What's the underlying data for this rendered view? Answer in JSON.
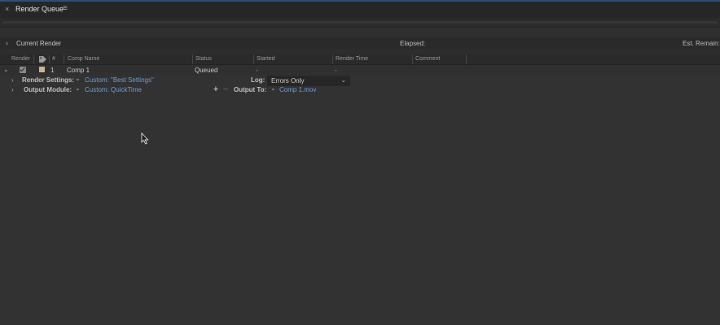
{
  "panel": {
    "title": "Render Queue",
    "close_icon": "×",
    "menu_icon": "≡"
  },
  "current_render": {
    "label": "Current Render",
    "elapsed_label": "Elapsed:",
    "remain_label": "Est. Remain:"
  },
  "columns": {
    "render": "Render",
    "number": "#",
    "comp_name": "Comp Name",
    "status": "Status",
    "started": "Started",
    "render_time": "Render Time",
    "comment": "Comment"
  },
  "queue_item": {
    "checked": true,
    "label_color": "#cbb48f",
    "number": "1",
    "comp_name": "Comp 1",
    "status": "Queued",
    "started": "-",
    "render_time": "-",
    "render_settings_label": "Render Settings:",
    "render_settings_value": "Custom: \"Best Settings\"",
    "log_label": "Log:",
    "log_value": "Errors Only",
    "output_module_label": "Output Module:",
    "output_module_value": "Custom: QuickTime",
    "output_to_label": "Output To:",
    "output_to_value": "Comp 1.mov"
  },
  "icons": {
    "chevron_right": "›",
    "chevron_down": "⌄",
    "plus": "+",
    "minus": "−"
  },
  "colors": {
    "background": "#323232",
    "link": "#6d9fd6",
    "accent_top": "#2d4f7c"
  }
}
